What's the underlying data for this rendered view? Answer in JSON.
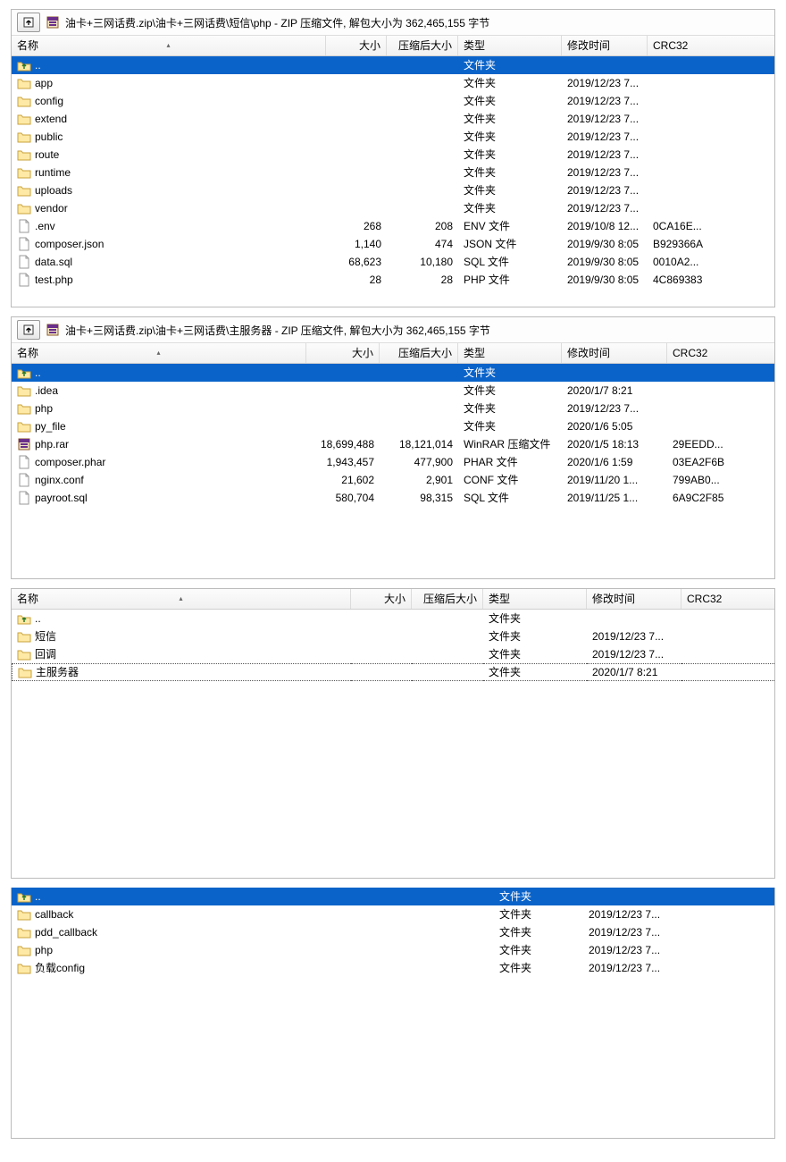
{
  "headers": {
    "name": "名称",
    "size": "大小",
    "packed": "压缩后大小",
    "type": "类型",
    "time": "修改时间",
    "crc": "CRC32"
  },
  "folder_type_label": "文件夹",
  "panel1": {
    "title": "油卡+三网话费.zip\\油卡+三网话费\\短信\\php - ZIP 压缩文件, 解包大小为 362,465,155 字节",
    "rows": [
      {
        "name": "..",
        "icon": "updir",
        "type": "文件夹",
        "selected": true
      },
      {
        "name": "app",
        "icon": "folder",
        "type": "文件夹",
        "time": "2019/12/23 7..."
      },
      {
        "name": "config",
        "icon": "folder",
        "type": "文件夹",
        "time": "2019/12/23 7..."
      },
      {
        "name": "extend",
        "icon": "folder",
        "type": "文件夹",
        "time": "2019/12/23 7..."
      },
      {
        "name": "public",
        "icon": "folder",
        "type": "文件夹",
        "time": "2019/12/23 7..."
      },
      {
        "name": "route",
        "icon": "folder",
        "type": "文件夹",
        "time": "2019/12/23 7..."
      },
      {
        "name": "runtime",
        "icon": "folder",
        "type": "文件夹",
        "time": "2019/12/23 7..."
      },
      {
        "name": "uploads",
        "icon": "folder",
        "type": "文件夹",
        "time": "2019/12/23 7..."
      },
      {
        "name": "vendor",
        "icon": "folder",
        "type": "文件夹",
        "time": "2019/12/23 7..."
      },
      {
        "name": ".env",
        "icon": "file",
        "size": "268",
        "packed": "208",
        "type": "ENV 文件",
        "time": "2019/10/8 12...",
        "crc": "0CA16E..."
      },
      {
        "name": "composer.json",
        "icon": "file",
        "size": "1,140",
        "packed": "474",
        "type": "JSON 文件",
        "time": "2019/9/30 8:05",
        "crc": "B929366A"
      },
      {
        "name": "data.sql",
        "icon": "file",
        "size": "68,623",
        "packed": "10,180",
        "type": "SQL 文件",
        "time": "2019/9/30 8:05",
        "crc": "0010A2..."
      },
      {
        "name": "test.php",
        "icon": "file",
        "size": "28",
        "packed": "28",
        "type": "PHP 文件",
        "time": "2019/9/30 8:05",
        "crc": "4C869383"
      }
    ],
    "filler": 1
  },
  "panel2": {
    "title": "油卡+三网话费.zip\\油卡+三网话费\\主服务器 - ZIP 压缩文件, 解包大小为 362,465,155 字节",
    "rows": [
      {
        "name": "..",
        "icon": "updir",
        "type": "文件夹",
        "selected": true
      },
      {
        "name": ".idea",
        "icon": "folder",
        "type": "文件夹",
        "time": "2020/1/7 8:21"
      },
      {
        "name": "php",
        "icon": "folder",
        "type": "文件夹",
        "time": "2019/12/23 7..."
      },
      {
        "name": "py_file",
        "icon": "folder",
        "type": "文件夹",
        "time": "2020/1/6 5:05"
      },
      {
        "name": "php.rar",
        "icon": "rar",
        "size": "18,699,488",
        "packed": "18,121,014",
        "type": "WinRAR 压缩文件",
        "time": "2020/1/5 18:13",
        "crc": "29EEDD..."
      },
      {
        "name": "composer.phar",
        "icon": "file",
        "size": "1,943,457",
        "packed": "477,900",
        "type": "PHAR 文件",
        "time": "2020/1/6 1:59",
        "crc": "03EA2F6B"
      },
      {
        "name": "nginx.conf",
        "icon": "file",
        "size": "21,602",
        "packed": "2,901",
        "type": "CONF 文件",
        "time": "2019/11/20 1...",
        "crc": "799AB0..."
      },
      {
        "name": "payroot.sql",
        "icon": "file",
        "size": "580,704",
        "packed": "98,315",
        "type": "SQL 文件",
        "time": "2019/11/25 1...",
        "crc": "6A9C2F85"
      }
    ],
    "filler": 4
  },
  "panel3": {
    "rows": [
      {
        "name": "..",
        "icon": "updir",
        "type": "文件夹"
      },
      {
        "name": "短信",
        "icon": "folder",
        "type": "文件夹",
        "time": "2019/12/23 7..."
      },
      {
        "name": "回调",
        "icon": "folder",
        "type": "文件夹",
        "time": "2019/12/23 7..."
      },
      {
        "name": "主服务器",
        "icon": "folder",
        "type": "文件夹",
        "time": "2020/1/7 8:21",
        "focus": true
      }
    ],
    "filler": 11
  },
  "panel4": {
    "rows": [
      {
        "name": "..",
        "icon": "updir",
        "type": "文件夹",
        "selected": true
      },
      {
        "name": "callback",
        "icon": "folder",
        "type": "文件夹",
        "time": "2019/12/23 7..."
      },
      {
        "name": "pdd_callback",
        "icon": "folder",
        "type": "文件夹",
        "time": "2019/12/23 7..."
      },
      {
        "name": "php",
        "icon": "folder",
        "type": "文件夹",
        "time": "2019/12/23 7..."
      },
      {
        "name": "负载config",
        "icon": "folder",
        "type": "文件夹",
        "time": "2019/12/23 7..."
      }
    ],
    "filler": 9
  }
}
